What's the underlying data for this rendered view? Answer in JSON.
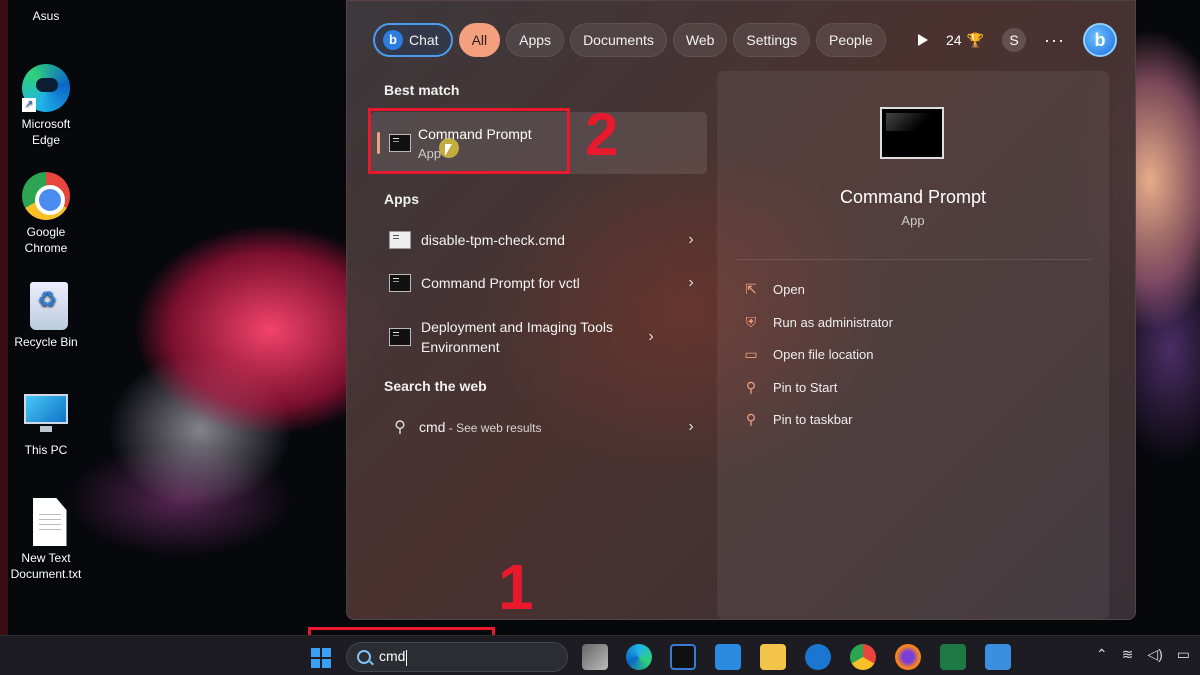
{
  "desktop": {
    "top_label": "Asus",
    "icons": [
      {
        "line1": "Microsoft",
        "line2": "Edge"
      },
      {
        "line1": "Google",
        "line2": "Chrome"
      },
      {
        "line1": "Recycle Bin",
        "line2": ""
      },
      {
        "line1": "This PC",
        "line2": ""
      },
      {
        "line1": "New Text",
        "line2": "Document.txt"
      }
    ]
  },
  "tabs": {
    "chat": "Chat",
    "all": "All",
    "apps": "Apps",
    "documents": "Documents",
    "web": "Web",
    "settings": "Settings",
    "people": "People",
    "points": "24",
    "avatar_letter": "S",
    "more": "···",
    "bing_letter": "b"
  },
  "results": {
    "best_match_heading": "Best match",
    "best_match": {
      "name": "Command Prompt",
      "type": "App"
    },
    "apps_heading": "Apps",
    "apps": [
      {
        "name": "disable-tpm-check.cmd"
      },
      {
        "name": "Command Prompt for vctl"
      },
      {
        "name": "Deployment and Imaging Tools Environment"
      }
    ],
    "web_heading": "Search the web",
    "web": {
      "query": "cmd",
      "suffix": " - See web results"
    }
  },
  "detail": {
    "title": "Command Prompt",
    "type": "App",
    "actions": [
      "Open",
      "Run as administrator",
      "Open file location",
      "Pin to Start",
      "Pin to taskbar"
    ]
  },
  "annotations": {
    "step1": "1",
    "step2": "2"
  },
  "taskbar": {
    "search_value": "cmd"
  },
  "colors": {
    "accent": "#f4a07e",
    "annotation_red": "#e8192c",
    "chat_border": "#4b9cf0"
  }
}
